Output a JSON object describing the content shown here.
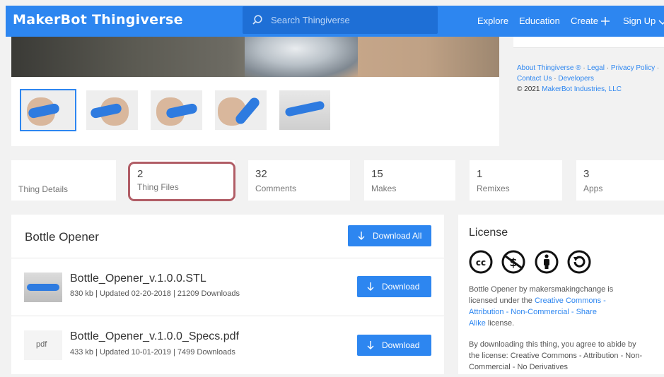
{
  "header": {
    "logo": "MakerBot Thingiverse",
    "search_placeholder": "Search Thingiverse",
    "nav": {
      "explore": "Explore",
      "education": "Education",
      "create": "Create",
      "signup": "Sign Up"
    }
  },
  "footer_links": {
    "about": "About Thingiverse ®",
    "legal": "Legal",
    "privacy": "Privacy Policy",
    "contact": "Contact Us",
    "developers": "Developers",
    "copyright_prefix": "© 2021",
    "copyright_company": "MakerBot Industries, LLC"
  },
  "stats": {
    "details_label": "Thing Details",
    "files_count": "2",
    "files_label": "Thing Files",
    "comments_count": "32",
    "comments_label": "Comments",
    "makes_count": "15",
    "makes_label": "Makes",
    "remixes_count": "1",
    "remixes_label": "Remixes",
    "apps_count": "3",
    "apps_label": "Apps"
  },
  "files": {
    "title": "Bottle Opener",
    "download_all": "Download All",
    "items": [
      {
        "name": "Bottle_Opener_v.1.0.0.STL",
        "meta": "830 kb | Updated 02-20-2018 | 21209 Downloads",
        "button": "Download"
      },
      {
        "name": "Bottle_Opener_v.1.0.0_Specs.pdf",
        "meta": "433 kb | Updated 10-01-2019 | 7499 Downloads",
        "button": "Download",
        "thumb_text": "pdf"
      }
    ]
  },
  "license": {
    "title": "License",
    "line1_prefix": "Bottle Opener by makersmakingchange is",
    "line2_prefix": "licensed under the",
    "line2_link": "Creative Commons -",
    "line3_link": "Attribution - Non-Commercial - Share",
    "line4_link": "Alike",
    "line4_suffix": "license.",
    "agree1": "By downloading this thing, you agree to abide by",
    "agree2": "the license: Creative Commons - Attribution - Non-",
    "agree3": "Commercial - No Derivatives"
  },
  "colors": {
    "brand_blue": "#2d86f0",
    "highlight": "#b15d66"
  }
}
